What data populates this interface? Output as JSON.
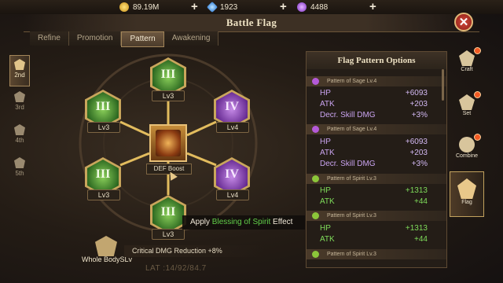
{
  "currency": {
    "gold": "89.19M",
    "diamond": "1923",
    "gem": "4488",
    "plus": "+"
  },
  "window": {
    "title": "Battle Flag",
    "close": "✕"
  },
  "tabs": [
    "Refine",
    "Promotion",
    "Pattern",
    "Awakening"
  ],
  "active_tab": "Pattern",
  "ranks": [
    "2nd",
    "3rd",
    "4th",
    "5th"
  ],
  "active_rank": "2nd",
  "nodes": {
    "top": {
      "glyph": "III",
      "level": "Lv3"
    },
    "left_top": {
      "glyph": "III",
      "level": "Lv3"
    },
    "right_top": {
      "glyph": "IV",
      "level": "Lv4"
    },
    "left_bottom": {
      "glyph": "III",
      "level": "Lv3"
    },
    "right_bottom": {
      "glyph": "IV",
      "level": "Lv4"
    },
    "bottom": {
      "glyph": "III",
      "level": "Lv3"
    }
  },
  "center": {
    "label": "DEF Boost"
  },
  "tooltip": {
    "prefix": "Apply ",
    "highlight": "Blessing of Spirit",
    "suffix": " Effect"
  },
  "bottom": {
    "whole_body": "Whole BodySLv",
    "crit": "Critical DMG Reduction +8%",
    "faint": "LAT :14/92/84.7"
  },
  "panel": {
    "title": "Flag Pattern Options",
    "sections": [
      {
        "name": "Pattern of Sage Lv.4",
        "color": "#b45ad8",
        "rows": [
          {
            "k": "HP",
            "v": "+6093"
          },
          {
            "k": "ATK",
            "v": "+203"
          },
          {
            "k": "Decr. Skill DMG",
            "v": "+3%"
          }
        ]
      },
      {
        "name": "Pattern of Sage Lv.4",
        "color": "#b45ad8",
        "rows": [
          {
            "k": "HP",
            "v": "+6093"
          },
          {
            "k": "ATK",
            "v": "+203"
          },
          {
            "k": "Decr. Skill DMG",
            "v": "+3%"
          }
        ]
      },
      {
        "name": "Pattern of Spirit Lv.3",
        "color": "#8cc63a",
        "rows": [
          {
            "k": "HP",
            "v": "+1313"
          },
          {
            "k": "ATK",
            "v": "+44"
          }
        ]
      },
      {
        "name": "Pattern of Spirit Lv.3",
        "color": "#8cc63a",
        "rows": [
          {
            "k": "HP",
            "v": "+1313"
          },
          {
            "k": "ATK",
            "v": "+44"
          }
        ]
      },
      {
        "name": "Pattern of Spirit Lv.3",
        "color": "#8cc63a",
        "rows": []
      }
    ]
  },
  "side_menu": [
    "Craft",
    "Set",
    "Combine",
    "Flag"
  ],
  "active_side": "Flag"
}
